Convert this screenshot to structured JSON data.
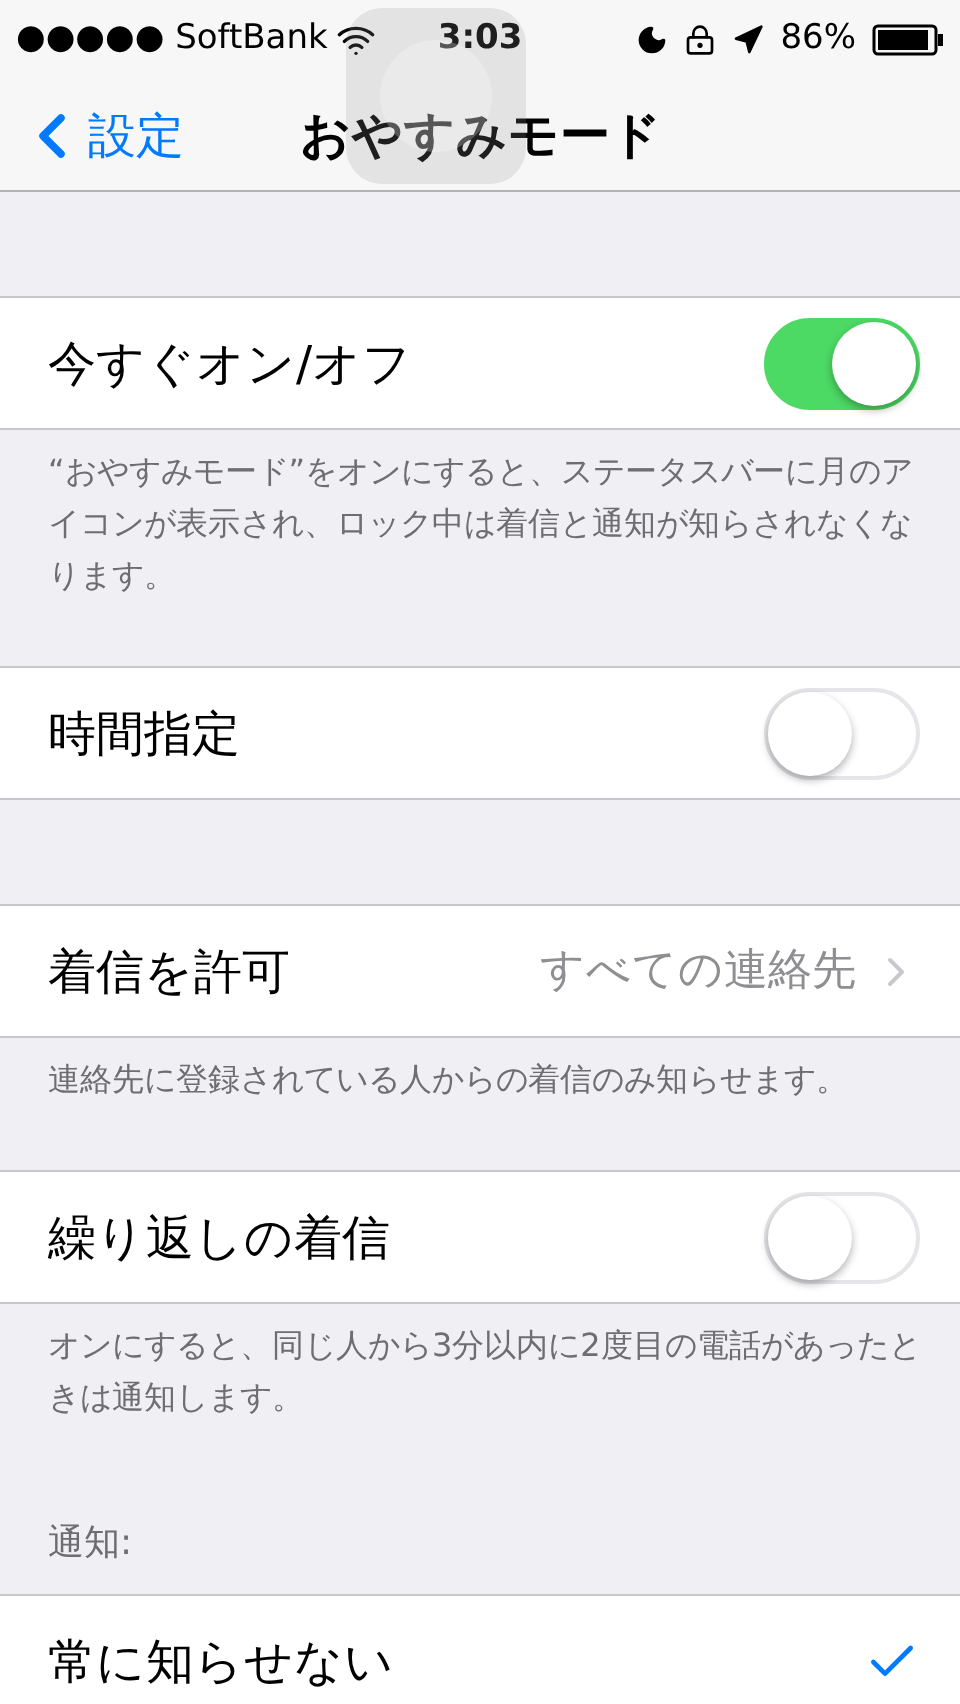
{
  "status_bar": {
    "carrier": "●●●●● SoftBank",
    "time": "3:03",
    "battery": "86%"
  },
  "nav": {
    "back": "設定",
    "title": "おやすみモード"
  },
  "sections": [
    {
      "rows": [
        {
          "kind": "toggle",
          "label": "今すぐオン/オフ",
          "on": true
        }
      ],
      "footer": "“おやすみモード”をオンにすると、ステータスバーに月のアイコンが表示され、ロック中は着信と通知が知らされなくなります。"
    },
    {
      "rows": [
        {
          "kind": "toggle",
          "label": "時間指定",
          "on": false
        }
      ]
    },
    {
      "rows": [
        {
          "kind": "disclosure",
          "label": "着信を許可",
          "value": "すべての連絡先"
        }
      ],
      "footer": "連絡先に登録されている人からの着信のみ知らせます。"
    },
    {
      "rows": [
        {
          "kind": "toggle",
          "label": "繰り返しの着信",
          "on": false
        }
      ],
      "footer": "オンにすると、同じ人から3分以内に2度目の電話があったときは通知します。"
    },
    {
      "header": "通知:",
      "rows": [
        {
          "kind": "check",
          "label": "常に知らせない",
          "selected": true
        }
      ]
    }
  ]
}
